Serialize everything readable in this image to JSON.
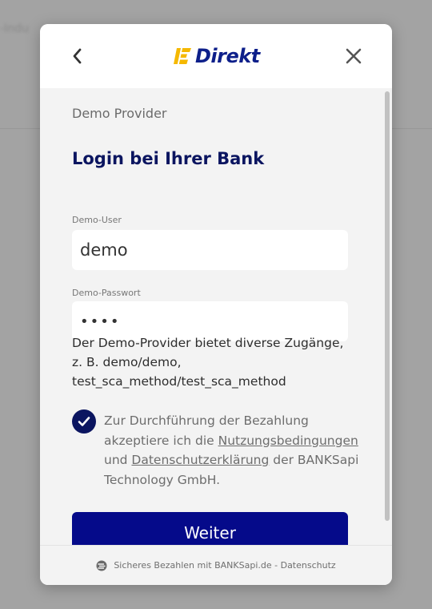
{
  "backdrop": {
    "text": "-Indu"
  },
  "header": {
    "logo_text": "Direkt"
  },
  "provider": {
    "name": "Demo Provider"
  },
  "title": "Login bei Ihrer Bank",
  "form": {
    "user_label": "Demo-User",
    "user_value": "demo",
    "password_label": "Demo-Passwort",
    "password_value": "demo"
  },
  "hint": "Der Demo-Provider bietet diverse Zugänge, z. B. demo/demo, test_sca_method/test_sca_method",
  "consent": {
    "checked": true,
    "text_before": "Zur Durchführung der Bezahlung akzeptiere ich die ",
    "terms_link": "Nutzungsbedingungen",
    "text_middle": " und ",
    "privacy_link": "Datenschutzerklärung",
    "text_after": " der BANKSapi Technology GmbH."
  },
  "submit_label": "Weiter",
  "footer": {
    "secure_text": "Sicheres Bezahlen mit BANKSapi.de",
    "separator": " - ",
    "privacy_link": "Datenschutz"
  },
  "colors": {
    "brand_navy": "#0b1560",
    "button": "#050a8a",
    "logo_yellow": "#f5b800"
  },
  "icons": [
    "chevron-left-icon",
    "close-icon",
    "checkmark-icon",
    "banksapi-logo-icon"
  ]
}
